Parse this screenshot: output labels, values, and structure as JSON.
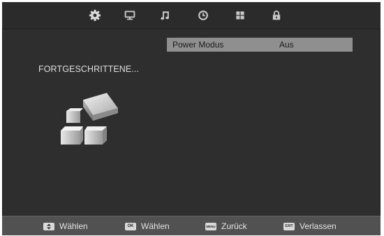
{
  "menu": {
    "tabs": [
      {
        "icon": "picture-gear-icon",
        "active": true
      },
      {
        "icon": "monitor-icon"
      },
      {
        "icon": "music-note-icon"
      },
      {
        "icon": "clock-icon"
      },
      {
        "icon": "grid-icon"
      },
      {
        "icon": "lock-icon"
      }
    ]
  },
  "section": {
    "title": "FORTGESCHRITTENE...",
    "icon": "advanced-settings-cubes-icon"
  },
  "settings": [
    {
      "label": "Power Modus",
      "value": "Aus",
      "selected": true
    }
  ],
  "footer": {
    "hints": [
      {
        "key": "",
        "key_icon": "up-down-arrows-icon",
        "label": "Wählen"
      },
      {
        "key": "OK",
        "label": "Wählen"
      },
      {
        "key": "MENU",
        "label": "Zurück"
      },
      {
        "key": "EXIT",
        "label": "Verlassen"
      }
    ]
  },
  "colors": {
    "background": "#2e2e2e",
    "selected_row": "#8f8f8f",
    "footer": "#515151",
    "text": "#dedede"
  }
}
